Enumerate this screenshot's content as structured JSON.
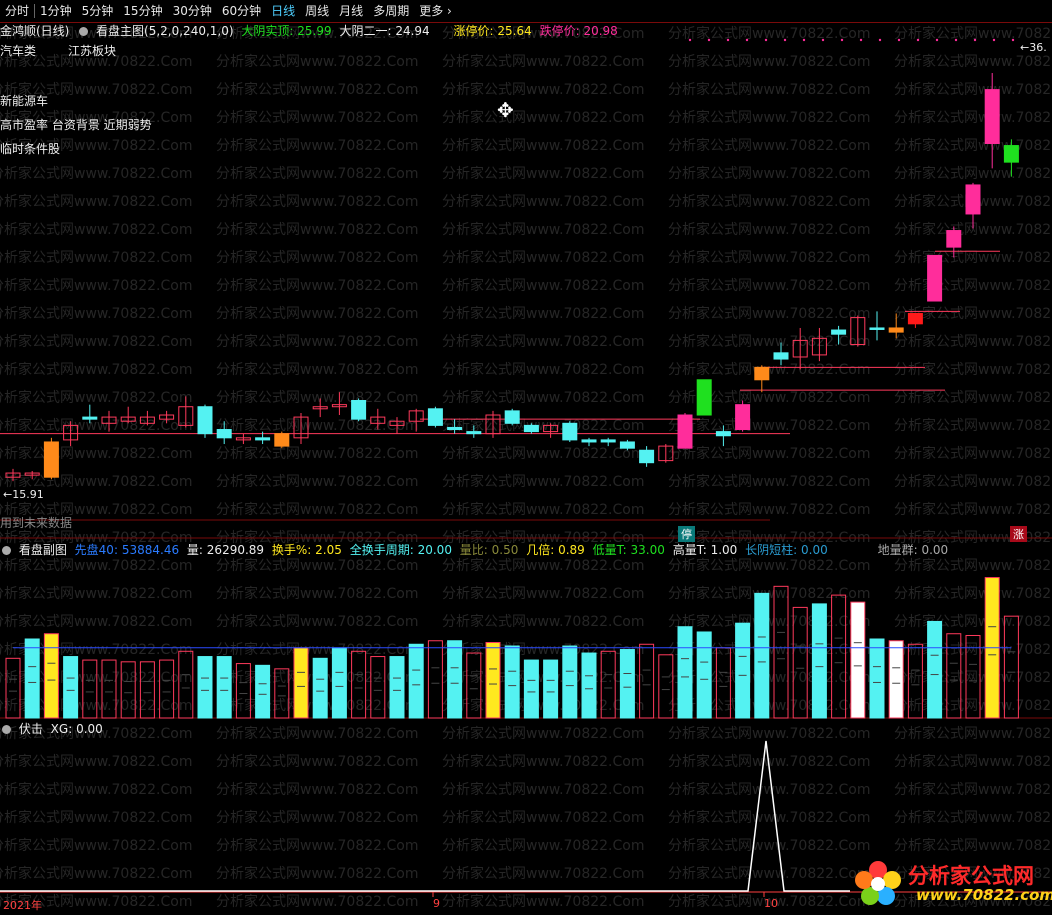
{
  "toolbar": {
    "periods": [
      "分时",
      "1分钟",
      "5分钟",
      "15分钟",
      "30分钟",
      "60分钟",
      "日线",
      "周线",
      "月线",
      "多周期",
      "更多"
    ],
    "active_index": 6
  },
  "main_panel": {
    "stock": "金鸿顺(日线)",
    "indicator": "看盘主图(5,2,0,240,1,0)",
    "yin_body_label": "大阴实顶:",
    "yin_body_value": "25.99",
    "yin_two_label": "大阴二一:",
    "yin_two_value": "24.94",
    "limit_up_label": "涨停价:",
    "limit_up_value": "25.64",
    "limit_down_label": "跌停价:",
    "limit_down_value": "20.98",
    "tag1": "汽车类",
    "tag2": "江苏板块",
    "tag3": "新能源车",
    "tag4": "高市盈率 台资背景 近期弱势",
    "tag5": "临时条件股",
    "future_hint": "用到未来数据",
    "low_marker": "←15.91",
    "high_marker": "←36.",
    "stop_badge": "停",
    "up_badge": "涨"
  },
  "sub_panel": {
    "title": "看盘副图",
    "first_label": "先盘40:",
    "first_value": "53884.46",
    "vol_label": "量:",
    "vol_value": "26290.89",
    "turn_label": "换手%:",
    "turn_value": "2.05",
    "full_turn_label": "全换手周期:",
    "full_turn_value": "20.00",
    "ratio_label": "量比:",
    "ratio_value": "0.50",
    "times_label": "几倍:",
    "times_value": "0.89",
    "low_vol_label": "低量T:",
    "low_vol_value": "33.00",
    "high_vol_label": "高量T:",
    "high_vol_value": "1.00",
    "long_yin_label": "长阴短柱:",
    "long_yin_value": "0.00",
    "ground_label": "地量群:",
    "ground_value": "0.00"
  },
  "bottom_panel": {
    "title": "伏击",
    "xg_label": "XG:",
    "xg_value": "0.00"
  },
  "time_axis": {
    "year": "2021年",
    "m9": "9",
    "m10": "10"
  },
  "watermark": "分析家公式网www.70822.Com",
  "logo": {
    "name": "分析家公式网",
    "url": "www.70822.com"
  },
  "colors": {
    "up": "#ff3a5c",
    "down": "#54f2f2",
    "bull": "#ff2d9b",
    "bear": "#1fe01f",
    "yellow": "#ffe81f",
    "grid": "#7a0a0a"
  },
  "chart_data": {
    "type": "candlestick",
    "ylim": [
      15,
      37
    ],
    "candles": [
      {
        "o": 16.1,
        "h": 16.5,
        "l": 15.91,
        "c": 16.3,
        "k": "up"
      },
      {
        "o": 16.2,
        "h": 16.4,
        "l": 16.0,
        "c": 16.3,
        "k": "up"
      },
      {
        "o": 17.8,
        "h": 18.0,
        "l": 16.0,
        "c": 16.1,
        "k": "mark"
      },
      {
        "o": 17.9,
        "h": 18.8,
        "l": 17.6,
        "c": 18.6,
        "k": "up"
      },
      {
        "o": 18.9,
        "h": 19.6,
        "l": 18.7,
        "c": 19.0,
        "k": "dn"
      },
      {
        "o": 18.7,
        "h": 19.3,
        "l": 18.3,
        "c": 19.0,
        "k": "up"
      },
      {
        "o": 18.8,
        "h": 19.5,
        "l": 18.7,
        "c": 19.0,
        "k": "up"
      },
      {
        "o": 18.7,
        "h": 19.3,
        "l": 18.6,
        "c": 19.0,
        "k": "up"
      },
      {
        "o": 18.9,
        "h": 19.3,
        "l": 18.7,
        "c": 19.1,
        "k": "up"
      },
      {
        "o": 18.6,
        "h": 20.0,
        "l": 18.5,
        "c": 19.5,
        "k": "up"
      },
      {
        "o": 19.5,
        "h": 19.6,
        "l": 18.0,
        "c": 18.2,
        "k": "dn"
      },
      {
        "o": 18.4,
        "h": 18.8,
        "l": 17.7,
        "c": 18.0,
        "k": "dn"
      },
      {
        "o": 17.9,
        "h": 18.2,
        "l": 17.7,
        "c": 18.0,
        "k": "up"
      },
      {
        "o": 17.9,
        "h": 18.3,
        "l": 17.7,
        "c": 18.0,
        "k": "dn"
      },
      {
        "o": 18.2,
        "h": 18.3,
        "l": 17.5,
        "c": 17.6,
        "k": "mark"
      },
      {
        "o": 18.0,
        "h": 19.2,
        "l": 17.7,
        "c": 19.0,
        "k": "up"
      },
      {
        "o": 19.4,
        "h": 19.9,
        "l": 19.0,
        "c": 19.5,
        "k": "up"
      },
      {
        "o": 19.6,
        "h": 20.2,
        "l": 19.1,
        "c": 19.5,
        "k": "up"
      },
      {
        "o": 19.8,
        "h": 19.9,
        "l": 18.8,
        "c": 18.9,
        "k": "dn"
      },
      {
        "o": 18.7,
        "h": 19.4,
        "l": 18.4,
        "c": 19.0,
        "k": "up"
      },
      {
        "o": 18.6,
        "h": 19.0,
        "l": 18.2,
        "c": 18.8,
        "k": "up"
      },
      {
        "o": 18.8,
        "h": 19.4,
        "l": 18.3,
        "c": 19.3,
        "k": "up"
      },
      {
        "o": 19.4,
        "h": 19.5,
        "l": 18.5,
        "c": 18.6,
        "k": "dn"
      },
      {
        "o": 18.5,
        "h": 18.9,
        "l": 18.2,
        "c": 18.4,
        "k": "dn"
      },
      {
        "o": 18.3,
        "h": 18.6,
        "l": 18.0,
        "c": 18.2,
        "k": "dn"
      },
      {
        "o": 18.2,
        "h": 19.3,
        "l": 18.0,
        "c": 19.1,
        "k": "up"
      },
      {
        "o": 19.3,
        "h": 19.4,
        "l": 18.6,
        "c": 18.7,
        "k": "dn"
      },
      {
        "o": 18.6,
        "h": 18.7,
        "l": 18.2,
        "c": 18.3,
        "k": "dn"
      },
      {
        "o": 18.3,
        "h": 18.7,
        "l": 18.0,
        "c": 18.6,
        "k": "up"
      },
      {
        "o": 18.7,
        "h": 18.8,
        "l": 17.8,
        "c": 17.9,
        "k": "dn"
      },
      {
        "o": 17.9,
        "h": 18.0,
        "l": 17.6,
        "c": 17.8,
        "k": "dn"
      },
      {
        "o": 17.9,
        "h": 18.0,
        "l": 17.6,
        "c": 17.8,
        "k": "dn"
      },
      {
        "o": 17.8,
        "h": 17.9,
        "l": 17.4,
        "c": 17.5,
        "k": "dn"
      },
      {
        "o": 17.4,
        "h": 17.6,
        "l": 16.6,
        "c": 16.8,
        "k": "dn"
      },
      {
        "o": 16.9,
        "h": 17.7,
        "l": 16.8,
        "c": 17.6,
        "k": "up"
      },
      {
        "o": 17.5,
        "h": 19.2,
        "l": 17.5,
        "c": 19.1,
        "k": "bull"
      },
      {
        "o": 20.8,
        "h": 20.8,
        "l": 19.1,
        "c": 19.1,
        "k": "bear"
      },
      {
        "o": 18.3,
        "h": 18.6,
        "l": 17.6,
        "c": 18.1,
        "k": "dn"
      },
      {
        "o": 18.4,
        "h": 19.8,
        "l": 18.3,
        "c": 19.6,
        "k": "bull"
      },
      {
        "o": 20.8,
        "h": 21.5,
        "l": 20.2,
        "c": 21.4,
        "k": "mark"
      },
      {
        "o": 22.1,
        "h": 22.6,
        "l": 21.5,
        "c": 21.8,
        "k": "dn"
      },
      {
        "o": 22.7,
        "h": 23.3,
        "l": 21.3,
        "c": 21.9,
        "k": "up"
      },
      {
        "o": 22.0,
        "h": 23.3,
        "l": 21.7,
        "c": 22.8,
        "k": "up"
      },
      {
        "o": 23.0,
        "h": 23.4,
        "l": 22.5,
        "c": 23.2,
        "k": "dn"
      },
      {
        "o": 22.5,
        "h": 23.9,
        "l": 22.4,
        "c": 23.8,
        "k": "up"
      },
      {
        "o": 23.3,
        "h": 24.1,
        "l": 22.7,
        "c": 23.3,
        "k": "dn"
      },
      {
        "o": 23.1,
        "h": 24.0,
        "l": 22.8,
        "c": 23.3,
        "k": "mark"
      },
      {
        "o": 23.5,
        "h": 24.0,
        "l": 23.3,
        "c": 24.0,
        "k": "solid_red"
      },
      {
        "o": 24.6,
        "h": 26.8,
        "l": 24.6,
        "c": 26.8,
        "k": "bull"
      },
      {
        "o": 27.2,
        "h": 28.2,
        "l": 26.7,
        "c": 28.0,
        "k": "bull"
      },
      {
        "o": 28.8,
        "h": 30.3,
        "l": 28.1,
        "c": 30.2,
        "k": "bull"
      },
      {
        "o": 32.2,
        "h": 35.6,
        "l": 31.0,
        "c": 34.8,
        "k": "bull"
      },
      {
        "o": 31.3,
        "h": 32.4,
        "l": 30.6,
        "c": 32.1,
        "k": "bear"
      }
    ],
    "volume_values": [
      34,
      45,
      48,
      35,
      33,
      33,
      32,
      32,
      33,
      38,
      35,
      35,
      31,
      30,
      28,
      40,
      34,
      40,
      38,
      35,
      35,
      42,
      44,
      44,
      37,
      43,
      41,
      33,
      33,
      41,
      37,
      38,
      39,
      42,
      36,
      52,
      49,
      40,
      54,
      71,
      75,
      63,
      65,
      70,
      66,
      45,
      44,
      42,
      55,
      48,
      47,
      80,
      58
    ]
  }
}
